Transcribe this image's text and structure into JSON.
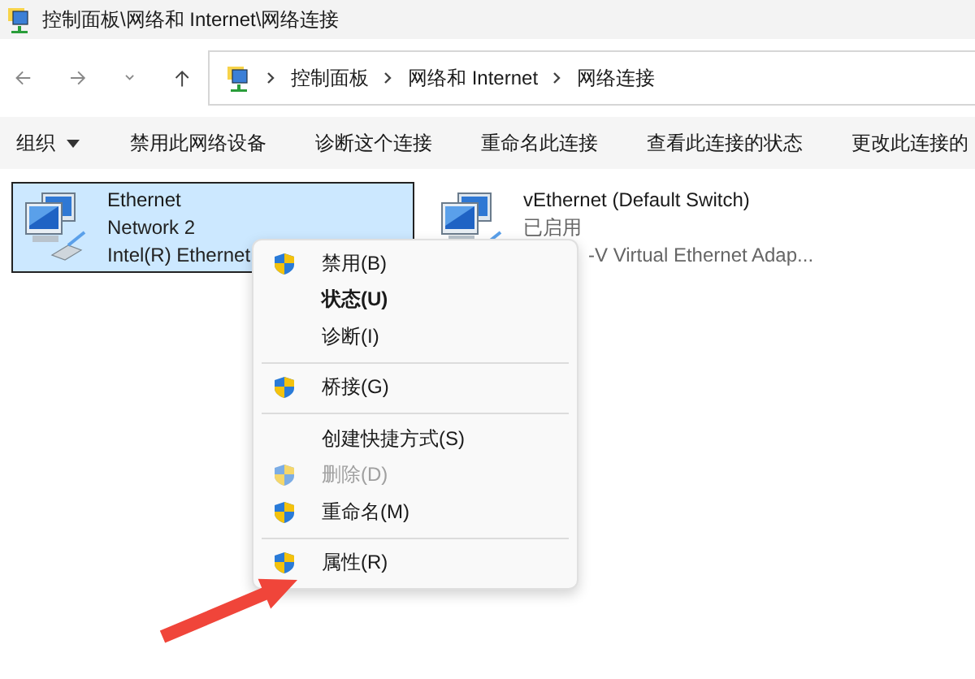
{
  "window": {
    "title": "控制面板\\网络和 Internet\\网络连接"
  },
  "address": {
    "crumbs": [
      "控制面板",
      "网络和 Internet",
      "网络连接"
    ]
  },
  "toolbar": [
    {
      "label": "组织",
      "dropdown": true
    },
    {
      "label": "禁用此网络设备",
      "dropdown": false
    },
    {
      "label": "诊断这个连接",
      "dropdown": false
    },
    {
      "label": "重命名此连接",
      "dropdown": false
    },
    {
      "label": "查看此连接的状态",
      "dropdown": false
    },
    {
      "label": "更改此连接的",
      "dropdown": false
    }
  ],
  "connections": [
    {
      "name": "Ethernet",
      "status": "Network 2",
      "adapter": "Intel(R) Ethernet",
      "selected": true,
      "dim_status": false
    },
    {
      "name": "vEthernet (Default Switch)",
      "status": "已启用",
      "adapter": "-V Virtual Ethernet Adap...",
      "selected": false,
      "dim_status": true
    }
  ],
  "context_menu": [
    {
      "kind": "item",
      "label": "禁用(B)",
      "shield": true,
      "bold": false,
      "disabled": false
    },
    {
      "kind": "item",
      "label": "状态(U)",
      "shield": false,
      "bold": true,
      "disabled": false
    },
    {
      "kind": "item",
      "label": "诊断(I)",
      "shield": false,
      "bold": false,
      "disabled": false
    },
    {
      "kind": "separator"
    },
    {
      "kind": "item",
      "label": "桥接(G)",
      "shield": true,
      "bold": false,
      "disabled": false
    },
    {
      "kind": "separator"
    },
    {
      "kind": "item",
      "label": "创建快捷方式(S)",
      "shield": false,
      "bold": false,
      "disabled": false
    },
    {
      "kind": "item",
      "label": "删除(D)",
      "shield": true,
      "bold": false,
      "disabled": true
    },
    {
      "kind": "item",
      "label": "重命名(M)",
      "shield": true,
      "bold": false,
      "disabled": false
    },
    {
      "kind": "separator"
    },
    {
      "kind": "item",
      "label": "属性(R)",
      "shield": true,
      "bold": false,
      "disabled": false
    }
  ]
}
